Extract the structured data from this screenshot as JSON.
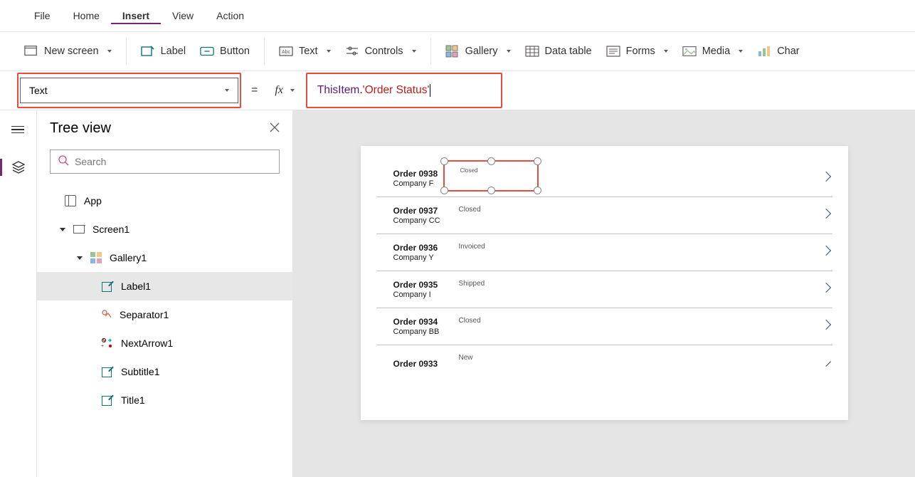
{
  "menu": {
    "items": [
      {
        "label": "File",
        "active": false
      },
      {
        "label": "Home",
        "active": false
      },
      {
        "label": "Insert",
        "active": true
      },
      {
        "label": "View",
        "active": false
      },
      {
        "label": "Action",
        "active": false
      }
    ]
  },
  "ribbon": {
    "new_screen": "New screen",
    "label": "Label",
    "button": "Button",
    "text": "Text",
    "controls": "Controls",
    "gallery": "Gallery",
    "data_table": "Data table",
    "forms": "Forms",
    "media": "Media",
    "charts": "Char"
  },
  "formula_bar": {
    "property_name": "Text",
    "formula_prefix": "ThisItem",
    "formula_dot": ".",
    "formula_column": "'Order Status'"
  },
  "tree_panel": {
    "title": "Tree view",
    "search_placeholder": "Search",
    "root": "App",
    "screen": "Screen1",
    "gallery": "Gallery1",
    "items": [
      {
        "name": "Label1",
        "selected": true
      },
      {
        "name": "Separator1",
        "selected": false
      },
      {
        "name": "NextArrow1",
        "selected": false
      },
      {
        "name": "Subtitle1",
        "selected": false
      },
      {
        "name": "Title1",
        "selected": false
      }
    ]
  },
  "gallery_data": [
    {
      "order": "Order 0938",
      "company": "Company F",
      "status": "Closed",
      "selected": true
    },
    {
      "order": "Order 0937",
      "company": "Company CC",
      "status": "Closed",
      "selected": false
    },
    {
      "order": "Order 0936",
      "company": "Company Y",
      "status": "Invoiced",
      "selected": false
    },
    {
      "order": "Order 0935",
      "company": "Company I",
      "status": "Shipped",
      "selected": false
    },
    {
      "order": "Order 0934",
      "company": "Company BB",
      "status": "Closed",
      "selected": false
    },
    {
      "order": "Order 0933",
      "company": "",
      "status": "New",
      "selected": false
    }
  ]
}
